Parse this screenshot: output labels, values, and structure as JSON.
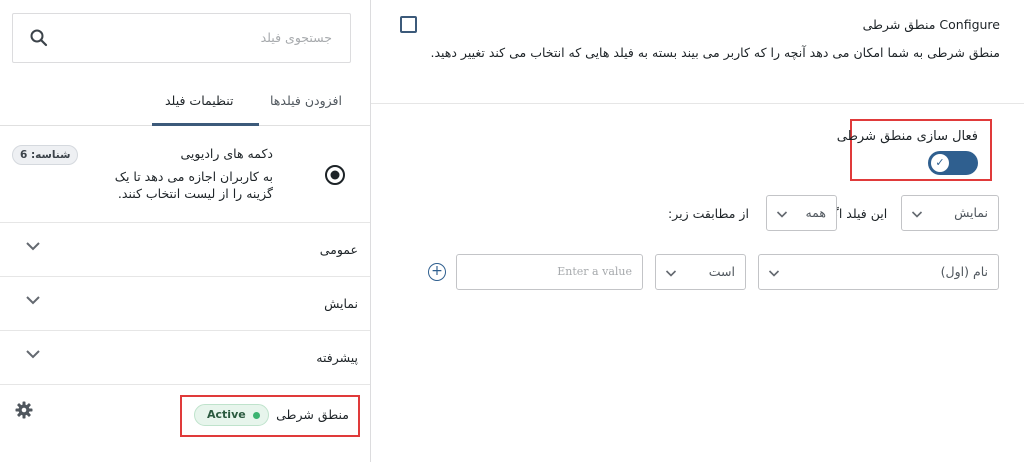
{
  "sidebar": {
    "search": {
      "placeholder": "جستجوی فیلد"
    },
    "tabs": [
      {
        "label": "افزودن فیلدها",
        "active": false
      },
      {
        "label": "تنظیمات فیلد",
        "active": true
      }
    ],
    "field": {
      "name": "دکمه های رادیویی",
      "description": "به کاربران اجازه می دهد تا یک گزینه را از لیست انتخاب کنند.",
      "id_badge": "شناسه: 6",
      "icon": "radio-button-icon"
    },
    "accordions": [
      {
        "label": "عمومی"
      },
      {
        "label": "نمایش"
      },
      {
        "label": "پیشرفته"
      }
    ],
    "conditional_logic": {
      "label": "منطق شرطی",
      "status": "Active",
      "status_color": "#3cb371"
    }
  },
  "config": {
    "title": "Configure منطق شرطی",
    "description": "منطق شرطی به شما امکان می دهد آنچه را که کاربر می بیند بسته به فیلد هایی که انتخاب می کند تغییر دهید.",
    "enable_label": "فعال سازی منطق شرطی",
    "toggle_on": true,
    "rule": {
      "action": "نمایش",
      "text_if": "این فیلد اگر",
      "match": "همه",
      "text_match": "از مطابقت زیر:",
      "field": "نام (اول)",
      "operator": "است",
      "value_placeholder": "Enter a value"
    },
    "accent_color": "#2f5f8f",
    "highlight_color": "#e03a3a"
  }
}
